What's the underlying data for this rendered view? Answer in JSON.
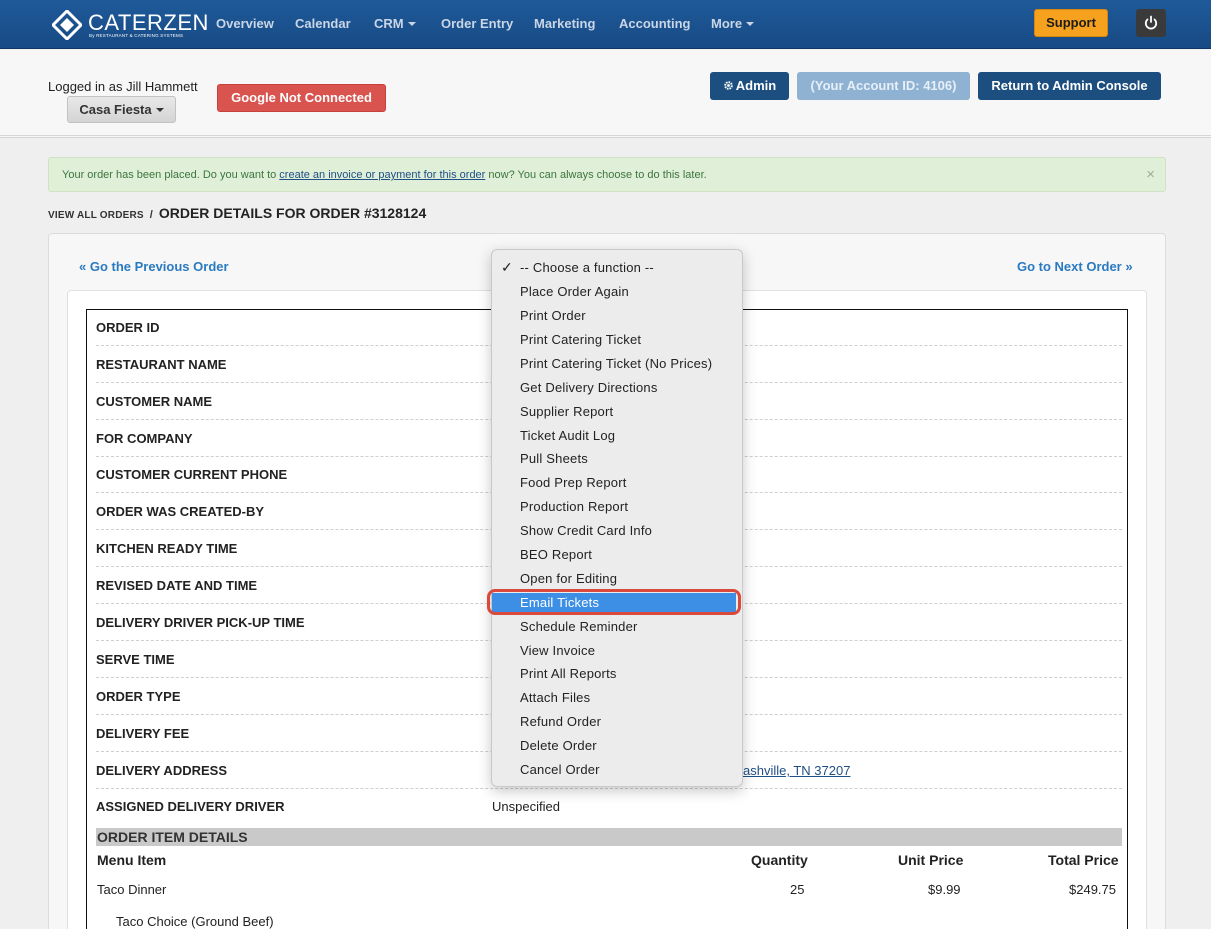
{
  "brand": {
    "name": "CaterZen",
    "name_display": "CATERZEN",
    "tagline": "By RESTAURANT & CATERING SYSTEMS"
  },
  "nav": {
    "items": [
      {
        "label": "Overview",
        "has_caret": false
      },
      {
        "label": "Calendar",
        "has_caret": false
      },
      {
        "label": "CRM",
        "has_caret": true
      },
      {
        "label": "Order Entry",
        "has_caret": false
      },
      {
        "label": "Marketing",
        "has_caret": false
      },
      {
        "label": "Accounting",
        "has_caret": false
      },
      {
        "label": "More",
        "has_caret": true
      }
    ],
    "support_label": "Support",
    "power_icon": "power-icon"
  },
  "header": {
    "logged_in_text": "Logged in as Jill Hammett",
    "restaurant_select": "Casa Fiesta",
    "google_status": "Google Not Connected",
    "admin_label": "Admin",
    "admin_icon": "gear-icon",
    "account_id_label": "(Your Account ID: 4106)",
    "return_label": "Return to Admin Console"
  },
  "alert": {
    "text_before": "Your order has been placed. Do you want to ",
    "link_text": "create an invoice or payment for this order",
    "text_after": " now? You can always choose to do this later.",
    "close": "×"
  },
  "breadcrumb": {
    "link": "VIEW ALL ORDERS",
    "separator": "/",
    "title": "ORDER DETAILS FOR ORDER #3128124"
  },
  "pager": {
    "prev": "« Go the Previous Order",
    "next": "Go to Next Order »"
  },
  "details": [
    {
      "label": "ORDER ID",
      "value": ""
    },
    {
      "label": "RESTAURANT NAME",
      "value": ""
    },
    {
      "label": "CUSTOMER NAME",
      "value": ""
    },
    {
      "label": "FOR COMPANY",
      "value": ""
    },
    {
      "label": "CUSTOMER CURRENT PHONE",
      "value": ""
    },
    {
      "label": "ORDER WAS CREATED-BY",
      "value": ""
    },
    {
      "label": "KITCHEN READY TIME",
      "value": ""
    },
    {
      "label": "REVISED DATE AND TIME",
      "value": ""
    },
    {
      "label": "DELIVERY DRIVER PICK-UP TIME",
      "value": ""
    },
    {
      "label": "SERVE TIME",
      "value": ""
    },
    {
      "label": "ORDER TYPE",
      "value": ""
    },
    {
      "label": "DELIVERY FEE",
      "value": ""
    },
    {
      "label": "DELIVERY ADDRESS",
      "value": "ashville, TN 37207"
    },
    {
      "label": "ASSIGNED DELIVERY DRIVER",
      "value": "Unspecified"
    }
  ],
  "items_section": {
    "title": "ORDER ITEM DETAILS",
    "headers": {
      "menu_item": "Menu Item",
      "quantity": "Quantity",
      "unit_price": "Unit Price",
      "total_price": "Total Price"
    },
    "rows": [
      {
        "menu_item": "Taco Dinner",
        "quantity": "25",
        "unit_price": "$9.99",
        "total_price": "$249.75"
      }
    ],
    "sub_item": "Taco Choice (Ground Beef)"
  },
  "function_menu": {
    "selected_index": 0,
    "highlighted_index": 14,
    "options": [
      "-- Choose a function --",
      "Place Order Again",
      "Print Order",
      "Print Catering Ticket",
      "Print Catering Ticket (No Prices)",
      "Get Delivery Directions",
      "Supplier Report",
      "Ticket Audit Log",
      "Pull Sheets",
      "Food Prep Report",
      "Production Report",
      "Show Credit Card Info",
      "BEO Report",
      "Open for Editing",
      "Email Tickets",
      "Schedule Reminder",
      "View Invoice",
      "Print All Reports",
      "Attach Files",
      "Refund Order",
      "Delete Order",
      "Cancel Order"
    ],
    "check_glyph": "✓"
  },
  "colors": {
    "nav_bg": "#1f5a9a",
    "support": "#f6a21e",
    "danger": "#d9534f",
    "primary": "#1c4f80",
    "highlight": "#3d8fe6",
    "ring": "#d9493c"
  }
}
